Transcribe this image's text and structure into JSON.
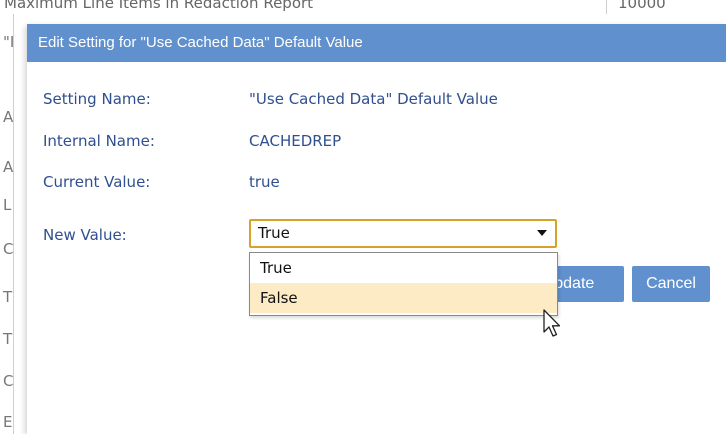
{
  "background": {
    "row_name": "Maximum Line Items in Redaction Report",
    "row_value": "10000",
    "left_letters": [
      "\"I",
      "A",
      "A",
      "L",
      "C",
      "T",
      "T",
      "C",
      "E"
    ]
  },
  "dialog": {
    "title": "Edit Setting for \"Use Cached Data\" Default Value",
    "fields": [
      {
        "label": "Setting Name:",
        "value": "\"Use Cached Data\" Default Value"
      },
      {
        "label": "Internal Name:",
        "value": "CACHEDREP"
      },
      {
        "label": "Current Value:",
        "value": "true"
      }
    ],
    "new_value_label": "New Value:",
    "select": {
      "selected": "True",
      "options": [
        "True",
        "False"
      ],
      "hovered_option": "False"
    },
    "update_button": "Update",
    "cancel_button": "Cancel"
  },
  "colors": {
    "title_bar": "#6090cd",
    "label_text": "#2f4f8f",
    "select_focus_border": "#d8a12a",
    "option_hover": "#fcebc5",
    "button": "#6090cd"
  },
  "icons": {
    "select_arrow": "chevron-down-icon",
    "cursor": "mouse-pointer-icon"
  }
}
